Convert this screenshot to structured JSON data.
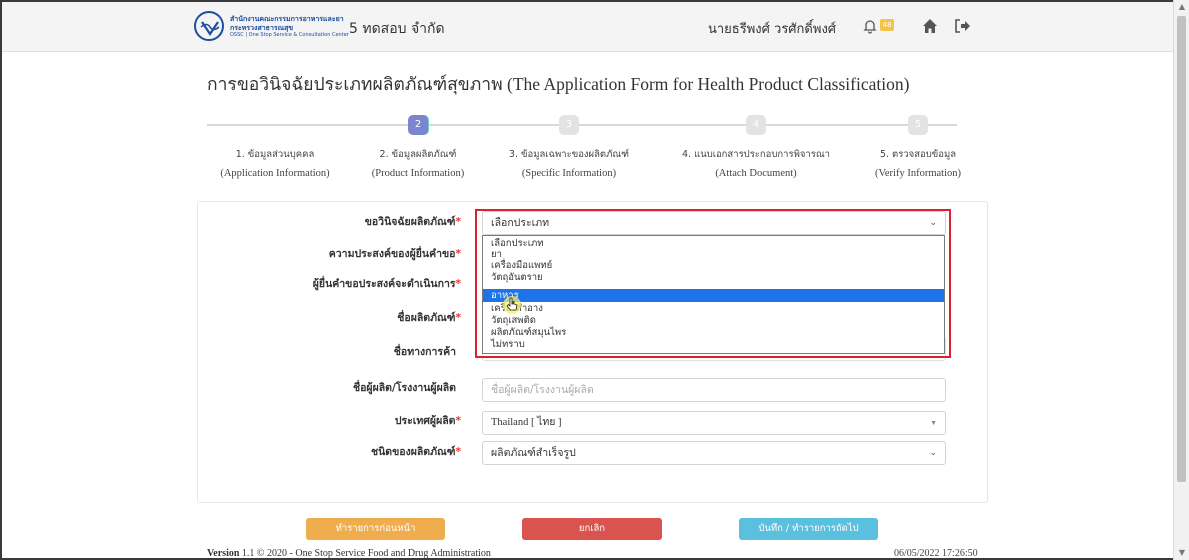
{
  "header": {
    "logo_line1": "สำนักงานคณะกรรมการอาหารและยา",
    "logo_line2": "กระทรวงสาธารณสุข",
    "logo_line3": "OSSC | One Stop Service & Consultation Center",
    "company": "5 ทดสอบ จำกัด",
    "username": "นายธรีพงศ์ วรศักดิ์พงศ์",
    "notification_count": "48"
  },
  "title": "การขอวินิจฉัยประเภทผลิตภัณฑ์สุขภาพ (The Application Form for Health Product Classification)",
  "steps": [
    {
      "num": "1",
      "th": "1. ข้อมูลส่วนบุคคล",
      "en": "(Application Information)",
      "color": "#6cd0c0"
    },
    {
      "num": "2",
      "th": "2. ข้อมูลผลิตภัณฑ์",
      "en": "(Product Information)",
      "color": "#7b86cf"
    },
    {
      "num": "3",
      "th": "3. ข้อมูลเฉพาะของผลิตภัณฑ์",
      "en": "(Specific Information)",
      "color": "#e3e3e3"
    },
    {
      "num": "4",
      "th": "4. แนบเอกสารประกอบการพิจารณา",
      "en": "(Attach Document)",
      "color": "#e3e3e3"
    },
    {
      "num": "5",
      "th": "5. ตรวจสอบข้อมูล",
      "en": "(Verify Information)",
      "color": "#e3e3e3"
    }
  ],
  "form": {
    "category_label": "ขอวินิจฉัยผลิตภัณฑ์",
    "category_value": "เลือกประเภท",
    "purpose_label": "ความประสงค์ของผู้ยื่นคำขอ",
    "action_label": "ผู้ยื่นคำขอประสงค์จะดำเนินการ",
    "product_name_label": "ชื่อผลิตภัณฑ์",
    "trade_name_label": "ชื่อทางการค้า",
    "manufacturer_label": "ชื่อผู้ผลิต/โรงงานผู้ผลิต",
    "manufacturer_placeholder": "ชื่อผู้ผลิต/โรงงานผู้ผลิต",
    "country_label": "ประเทศผู้ผลิต",
    "country_value": "Thailand [ ไทย ]",
    "product_type_label": "ชนิดของผลิตภัณฑ์",
    "product_type_value": "ผลิตภัณฑ์สำเร็จรูป",
    "required_mark": "*"
  },
  "dropdown_options": [
    "เลือกประเภท",
    "ยา",
    "เครื่องมือแพทย์",
    "วัตถุอันตราย",
    "อาหาร",
    "เครื่องสำอาง",
    "วัตถุเสพติด",
    "ผลิตภัณฑ์สมุนไพร",
    "ไม่ทราบ"
  ],
  "selected_option_index": 4,
  "buttons": {
    "prev": "ทำรายการก่อนหน้า",
    "cancel": "ยกเลิก",
    "next": "บันทึก / ทำรายการถัดไป"
  },
  "footer": {
    "version_label": "Version",
    "version_text": "1.1 © 2020 - One Stop Service Food and Drug Administration",
    "datetime": "06/05/2022 17:26:50"
  }
}
